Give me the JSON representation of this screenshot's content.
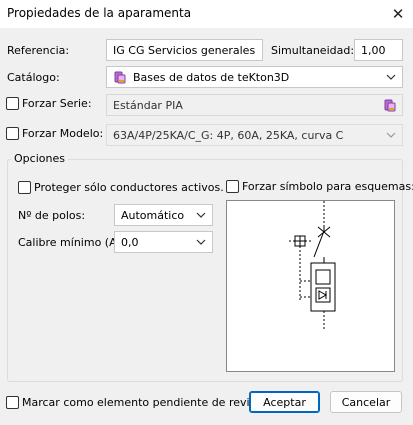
{
  "window": {
    "title": "Propiedades de la aparamenta",
    "close_glyph": "✕"
  },
  "referencia": {
    "label": "Referencia:",
    "value": "IG CG Servicios generales"
  },
  "simultaneidad": {
    "label": "Simultaneidad:",
    "value": "1,00"
  },
  "catalogo": {
    "label": "Catálogo:",
    "value": "Bases de datos de teKton3D",
    "icon": "database-icon"
  },
  "forzar_serie": {
    "label": "Forzar Serie:",
    "value": "Estándar PIA",
    "checked": false,
    "icon": "database-icon"
  },
  "forzar_modelo": {
    "label": "Forzar Modelo:",
    "value": "63A/4P/25KA/C_G: 4P, 60A, 25KA, curva C",
    "checked": false
  },
  "opciones": {
    "legend": "Opciones",
    "proteger_label": "Proteger sólo conductores activos.",
    "forzar_simbolo_label": "Forzar símbolo para esquemas:",
    "num_polos": {
      "label": "Nº de polos:",
      "value": "Automático"
    },
    "calibre": {
      "label": "Calibre mínimo (A):",
      "value": "0,0"
    }
  },
  "footer": {
    "marcar_label": "Marcar como elemento pendiente de revisión.",
    "accept_label": "Aceptar",
    "cancel_label": "Cancelar"
  },
  "colors": {
    "accent": "#0067c0",
    "icon_purple": "#7b3fa0"
  }
}
